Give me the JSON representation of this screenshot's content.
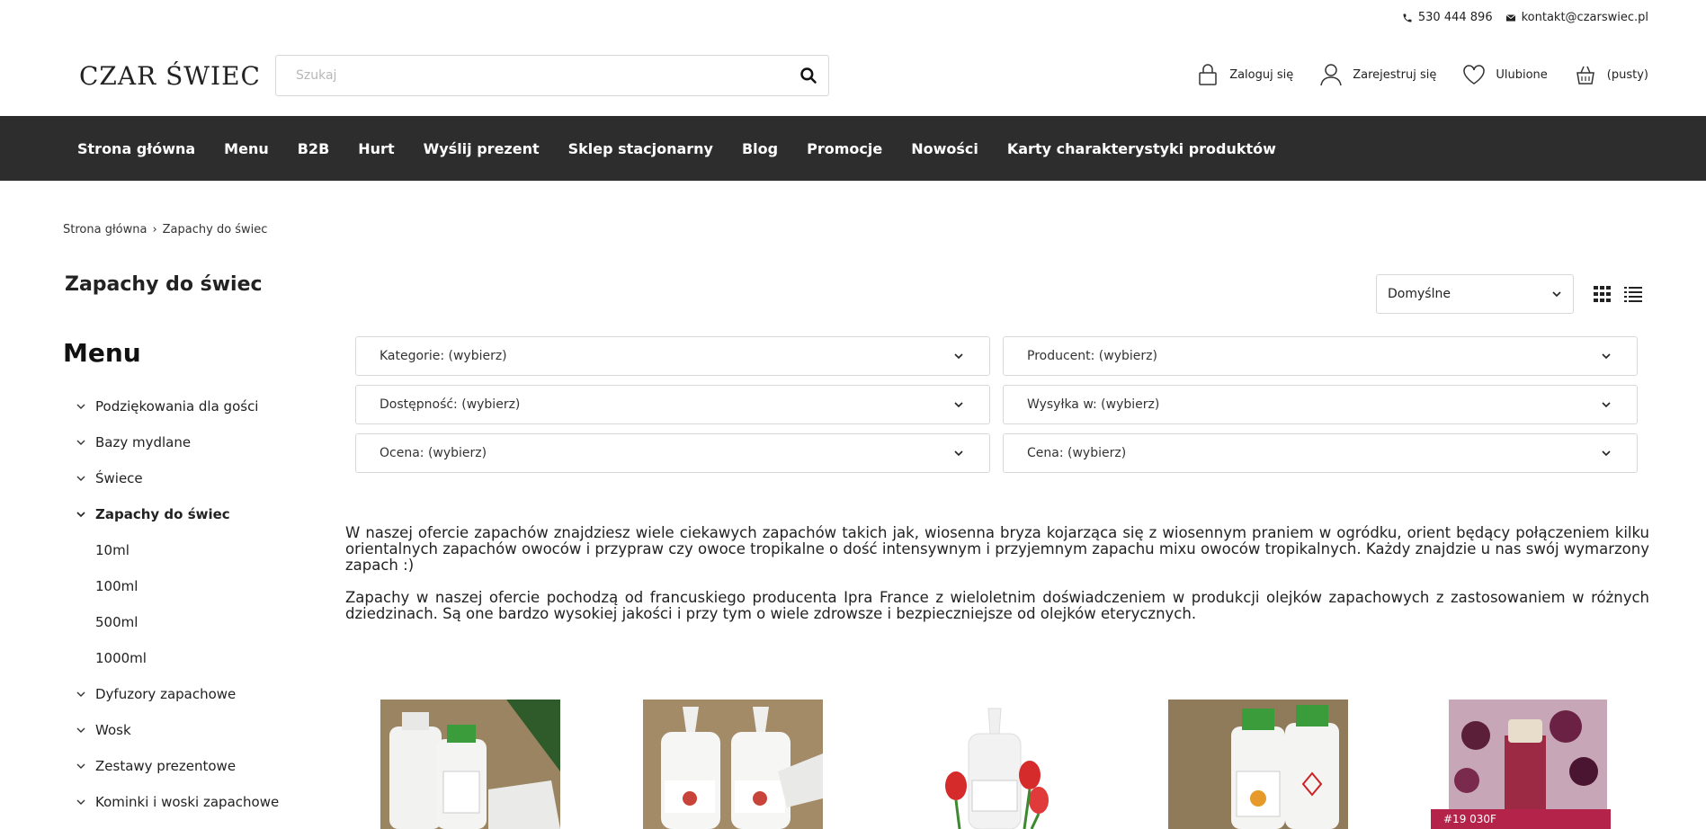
{
  "topbar": {
    "phone": "530 444 896",
    "email": "kontakt@czarswiec.pl"
  },
  "header": {
    "logo": "CZAR ŚWIEC",
    "search": {
      "placeholder": "Szukaj",
      "value": ""
    },
    "actions": {
      "login": "Zaloguj się",
      "register": "Zarejestruj się",
      "favorites": "Ulubione",
      "cart": "(pusty)"
    }
  },
  "nav": {
    "items": [
      "Strona główna",
      "Menu",
      "B2B",
      "Hurt",
      "Wyślij prezent",
      "Sklep stacjonarny",
      "Blog",
      "Promocje",
      "Nowości",
      "Karty charakterystyki produktów"
    ]
  },
  "breadcrumb": {
    "home": "Strona główna",
    "separator": "›",
    "current": "Zapachy do świec"
  },
  "page_title": "Zapachy do świec",
  "sort": {
    "selected": "Domyślne"
  },
  "sidebar": {
    "title": "Menu",
    "items": [
      {
        "label": "Podziękowania dla gości"
      },
      {
        "label": "Bazy mydlane"
      },
      {
        "label": "Świece"
      },
      {
        "label": "Zapachy do świec"
      },
      {
        "label": "10ml"
      },
      {
        "label": "100ml"
      },
      {
        "label": "500ml"
      },
      {
        "label": "1000ml"
      },
      {
        "label": "Dyfuzory zapachowe"
      },
      {
        "label": "Wosk"
      },
      {
        "label": "Zestawy prezentowe"
      },
      {
        "label": "Kominki i woski zapachowe"
      }
    ]
  },
  "filters": {
    "category": "Kategorie: (wybierz)",
    "producer": "Producent: (wybierz)",
    "availability": "Dostępność: (wybierz)",
    "shipping": "Wysyłka w: (wybierz)",
    "rating": "Ocena: (wybierz)",
    "price": "Cena: (wybierz)"
  },
  "description": {
    "p1": "W naszej ofercie zapachów znajdziesz wiele ciekawych zapachów takich jak, wiosenna bryza kojarząca się z wiosennym praniem w ogródku, orient będący połączeniem kilku orientalnych zapachów owoców i przypraw czy owoce tropikalne o dość intensywnym i przyjemnym zapachu mixu owoców tropikalnych. Każdy znajdzie u nas swój wymarzony zapach :)",
    "p2": "Zapachy w naszej ofercie pochodzą od francuskiego producenta Ipra France z wieloletnim doświadczeniem w produkcji olejków zapachowych z zastosowaniem w różnych dziedzinach. Są one bardzo wysokiej jakości i przy tym o wiele zdrowsze i bezpieczniejsze od olejków eterycznych."
  },
  "products": {
    "badge_5": "#19 030F"
  },
  "colors": {
    "nav_bg": "#2d2d2d",
    "badge": "#b3234a",
    "border": "#d7d7d7"
  },
  "icons": [
    "phone-icon",
    "mail-icon",
    "search-icon",
    "lock-icon",
    "user-icon",
    "heart-icon",
    "basket-icon",
    "chevron-down-icon",
    "grid-view-icon",
    "list-view-icon"
  ]
}
